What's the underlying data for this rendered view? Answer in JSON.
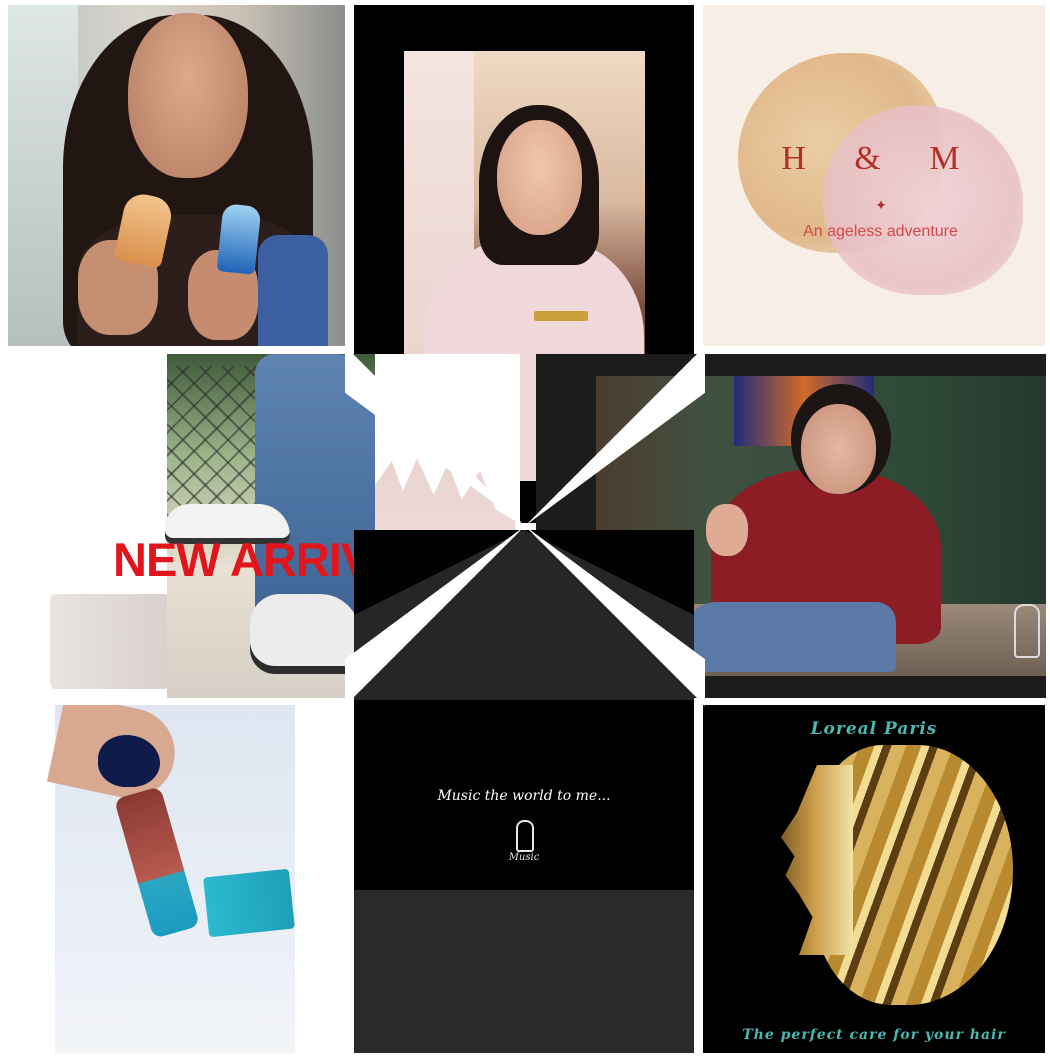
{
  "collage": {
    "tile_hm": {
      "title": "H & M",
      "star": "✦",
      "subtitle": "An ageless adventure"
    },
    "tile_new_arrival": {
      "text": "NEW ARRIVAL"
    },
    "tile_music": {
      "text": "Music the world to me...",
      "logo_text": "Music"
    },
    "tile_loreal": {
      "title": "Loreal Paris",
      "subtitle": "The perfect care for your hair"
    }
  },
  "colors": {
    "hm_red": "#b2302a",
    "new_arrival_red": "#e0161c",
    "loreal_teal": "#4bb8b2",
    "background": "#ffffff"
  }
}
